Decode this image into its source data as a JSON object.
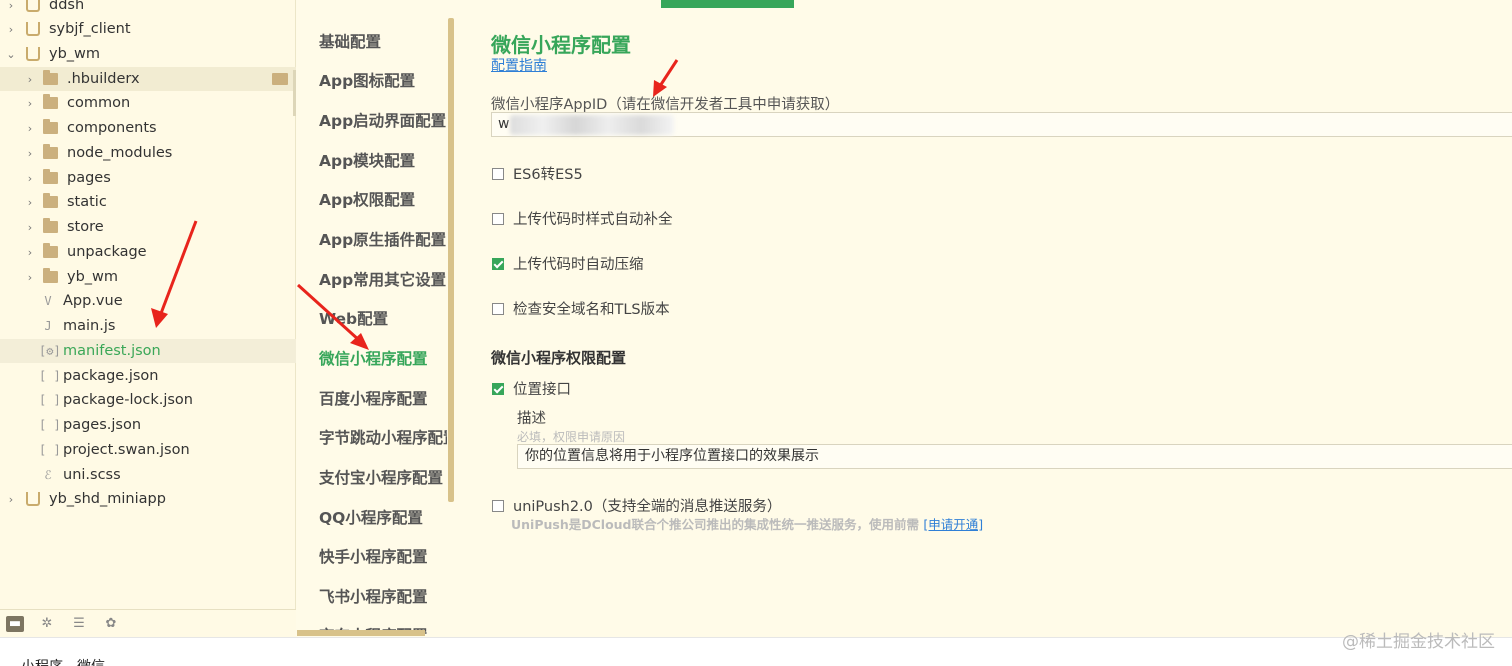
{
  "tree": {
    "items": [
      {
        "label": "ddsh",
        "kind": "project",
        "twisty": "›"
      },
      {
        "label": "sybjf_client",
        "kind": "project",
        "twisty": "›"
      },
      {
        "label": "yb_wm",
        "kind": "project",
        "twisty": "⌄"
      },
      {
        "label": ".hbuilderx",
        "kind": "folder",
        "twisty": "›"
      },
      {
        "label": "common",
        "kind": "folder",
        "twisty": "›"
      },
      {
        "label": "components",
        "kind": "folder",
        "twisty": "›"
      },
      {
        "label": "node_modules",
        "kind": "folder",
        "twisty": "›"
      },
      {
        "label": "pages",
        "kind": "folder",
        "twisty": "›"
      },
      {
        "label": "static",
        "kind": "folder",
        "twisty": "›"
      },
      {
        "label": "store",
        "kind": "folder",
        "twisty": "›"
      },
      {
        "label": "unpackage",
        "kind": "folder",
        "twisty": "›"
      },
      {
        "label": "yb_wm",
        "kind": "folder",
        "twisty": "›"
      },
      {
        "label": "App.vue",
        "kind": "file",
        "icon": "V"
      },
      {
        "label": "main.js",
        "kind": "file",
        "icon": "J"
      },
      {
        "label": "manifest.json",
        "kind": "file",
        "icon": "[⚙]"
      },
      {
        "label": "package.json",
        "kind": "file",
        "icon": "[ ]"
      },
      {
        "label": "package-lock.json",
        "kind": "file",
        "icon": "[ ]"
      },
      {
        "label": "pages.json",
        "kind": "file",
        "icon": "[ ]"
      },
      {
        "label": "project.swan.json",
        "kind": "file",
        "icon": "[ ]"
      },
      {
        "label": "uni.scss",
        "kind": "file",
        "icon": "ℰ"
      },
      {
        "label": "yb_shd_miniapp",
        "kind": "project",
        "twisty": "›"
      }
    ]
  },
  "nav": {
    "items": [
      "基础配置",
      "App图标配置",
      "App启动界面配置",
      "App模块配置",
      "App权限配置",
      "App原生插件配置",
      "App常用其它设置",
      "Web配置",
      "微信小程序配置",
      "百度小程序配置",
      "字节跳动小程序配置",
      "支付宝小程序配置",
      "QQ小程序配置",
      "快手小程序配置",
      "飞书小程序配置",
      "京东小程序配置"
    ]
  },
  "main": {
    "title": "微信小程序配置",
    "guide_link": "配置指南",
    "appid_label": "微信小程序AppID（请在微信开发者工具中申请获取）",
    "appid_value": "w",
    "options": [
      {
        "label": "ES6转ES5",
        "checked": false
      },
      {
        "label": "上传代码时样式自动补全",
        "checked": false
      },
      {
        "label": "上传代码时自动压缩",
        "checked": true
      },
      {
        "label": "检查安全域名和TLS版本",
        "checked": false
      }
    ],
    "permission_title": "微信小程序权限配置",
    "location": {
      "label": "位置接口",
      "checked": true
    },
    "desc_label": "描述",
    "desc_hint": "必填，权限申请原因",
    "desc_value": "你的位置信息将用于小程序位置接口的效果展示",
    "unipush": {
      "label": "uniPush2.0（支持全端的消息推送服务）",
      "checked": false
    },
    "unipush_desc": "UniPush是DCloud联合个推公司推出的集成性统一推送服务，使用前需 ",
    "unipush_link": "[申请开通]"
  },
  "status": {
    "text": "小程序 - 微信"
  },
  "watermark": "@稀土掘金技术社区",
  "colors": {
    "accent": "#37a65a",
    "arrow": "#e8241c",
    "link": "#2f7fd6"
  }
}
